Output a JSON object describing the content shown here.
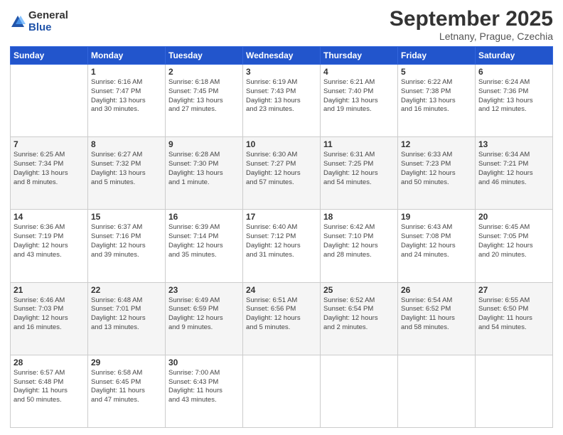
{
  "logo": {
    "general": "General",
    "blue": "Blue"
  },
  "header": {
    "month": "September 2025",
    "location": "Letnany, Prague, Czechia"
  },
  "days_of_week": [
    "Sunday",
    "Monday",
    "Tuesday",
    "Wednesday",
    "Thursday",
    "Friday",
    "Saturday"
  ],
  "weeks": [
    [
      {
        "day": "",
        "info": ""
      },
      {
        "day": "1",
        "info": "Sunrise: 6:16 AM\nSunset: 7:47 PM\nDaylight: 13 hours\nand 30 minutes."
      },
      {
        "day": "2",
        "info": "Sunrise: 6:18 AM\nSunset: 7:45 PM\nDaylight: 13 hours\nand 27 minutes."
      },
      {
        "day": "3",
        "info": "Sunrise: 6:19 AM\nSunset: 7:43 PM\nDaylight: 13 hours\nand 23 minutes."
      },
      {
        "day": "4",
        "info": "Sunrise: 6:21 AM\nSunset: 7:40 PM\nDaylight: 13 hours\nand 19 minutes."
      },
      {
        "day": "5",
        "info": "Sunrise: 6:22 AM\nSunset: 7:38 PM\nDaylight: 13 hours\nand 16 minutes."
      },
      {
        "day": "6",
        "info": "Sunrise: 6:24 AM\nSunset: 7:36 PM\nDaylight: 13 hours\nand 12 minutes."
      }
    ],
    [
      {
        "day": "7",
        "info": "Sunrise: 6:25 AM\nSunset: 7:34 PM\nDaylight: 13 hours\nand 8 minutes."
      },
      {
        "day": "8",
        "info": "Sunrise: 6:27 AM\nSunset: 7:32 PM\nDaylight: 13 hours\nand 5 minutes."
      },
      {
        "day": "9",
        "info": "Sunrise: 6:28 AM\nSunset: 7:30 PM\nDaylight: 13 hours\nand 1 minute."
      },
      {
        "day": "10",
        "info": "Sunrise: 6:30 AM\nSunset: 7:27 PM\nDaylight: 12 hours\nand 57 minutes."
      },
      {
        "day": "11",
        "info": "Sunrise: 6:31 AM\nSunset: 7:25 PM\nDaylight: 12 hours\nand 54 minutes."
      },
      {
        "day": "12",
        "info": "Sunrise: 6:33 AM\nSunset: 7:23 PM\nDaylight: 12 hours\nand 50 minutes."
      },
      {
        "day": "13",
        "info": "Sunrise: 6:34 AM\nSunset: 7:21 PM\nDaylight: 12 hours\nand 46 minutes."
      }
    ],
    [
      {
        "day": "14",
        "info": "Sunrise: 6:36 AM\nSunset: 7:19 PM\nDaylight: 12 hours\nand 43 minutes."
      },
      {
        "day": "15",
        "info": "Sunrise: 6:37 AM\nSunset: 7:16 PM\nDaylight: 12 hours\nand 39 minutes."
      },
      {
        "day": "16",
        "info": "Sunrise: 6:39 AM\nSunset: 7:14 PM\nDaylight: 12 hours\nand 35 minutes."
      },
      {
        "day": "17",
        "info": "Sunrise: 6:40 AM\nSunset: 7:12 PM\nDaylight: 12 hours\nand 31 minutes."
      },
      {
        "day": "18",
        "info": "Sunrise: 6:42 AM\nSunset: 7:10 PM\nDaylight: 12 hours\nand 28 minutes."
      },
      {
        "day": "19",
        "info": "Sunrise: 6:43 AM\nSunset: 7:08 PM\nDaylight: 12 hours\nand 24 minutes."
      },
      {
        "day": "20",
        "info": "Sunrise: 6:45 AM\nSunset: 7:05 PM\nDaylight: 12 hours\nand 20 minutes."
      }
    ],
    [
      {
        "day": "21",
        "info": "Sunrise: 6:46 AM\nSunset: 7:03 PM\nDaylight: 12 hours\nand 16 minutes."
      },
      {
        "day": "22",
        "info": "Sunrise: 6:48 AM\nSunset: 7:01 PM\nDaylight: 12 hours\nand 13 minutes."
      },
      {
        "day": "23",
        "info": "Sunrise: 6:49 AM\nSunset: 6:59 PM\nDaylight: 12 hours\nand 9 minutes."
      },
      {
        "day": "24",
        "info": "Sunrise: 6:51 AM\nSunset: 6:56 PM\nDaylight: 12 hours\nand 5 minutes."
      },
      {
        "day": "25",
        "info": "Sunrise: 6:52 AM\nSunset: 6:54 PM\nDaylight: 12 hours\nand 2 minutes."
      },
      {
        "day": "26",
        "info": "Sunrise: 6:54 AM\nSunset: 6:52 PM\nDaylight: 11 hours\nand 58 minutes."
      },
      {
        "day": "27",
        "info": "Sunrise: 6:55 AM\nSunset: 6:50 PM\nDaylight: 11 hours\nand 54 minutes."
      }
    ],
    [
      {
        "day": "28",
        "info": "Sunrise: 6:57 AM\nSunset: 6:48 PM\nDaylight: 11 hours\nand 50 minutes."
      },
      {
        "day": "29",
        "info": "Sunrise: 6:58 AM\nSunset: 6:45 PM\nDaylight: 11 hours\nand 47 minutes."
      },
      {
        "day": "30",
        "info": "Sunrise: 7:00 AM\nSunset: 6:43 PM\nDaylight: 11 hours\nand 43 minutes."
      },
      {
        "day": "",
        "info": ""
      },
      {
        "day": "",
        "info": ""
      },
      {
        "day": "",
        "info": ""
      },
      {
        "day": "",
        "info": ""
      }
    ]
  ]
}
